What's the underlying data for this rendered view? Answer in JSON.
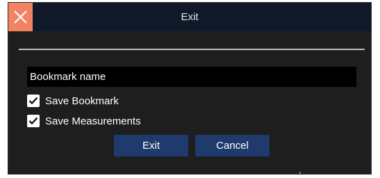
{
  "window": {
    "title": "Exit",
    "close_icon": "close-x-icon",
    "close_color": "#f08462",
    "titlebar_color": "#10192a"
  },
  "form": {
    "bookmark_name_placeholder": "Bookmark name",
    "bookmark_name_value": "",
    "checkboxes": [
      {
        "label": "Save Bookmark",
        "checked": true
      },
      {
        "label": "Save Measurements",
        "checked": true
      }
    ]
  },
  "buttons": {
    "exit_label": "Exit",
    "cancel_label": "Cancel",
    "button_color": "#1f3b6e"
  },
  "icons": {
    "check": "checkmark-icon"
  }
}
